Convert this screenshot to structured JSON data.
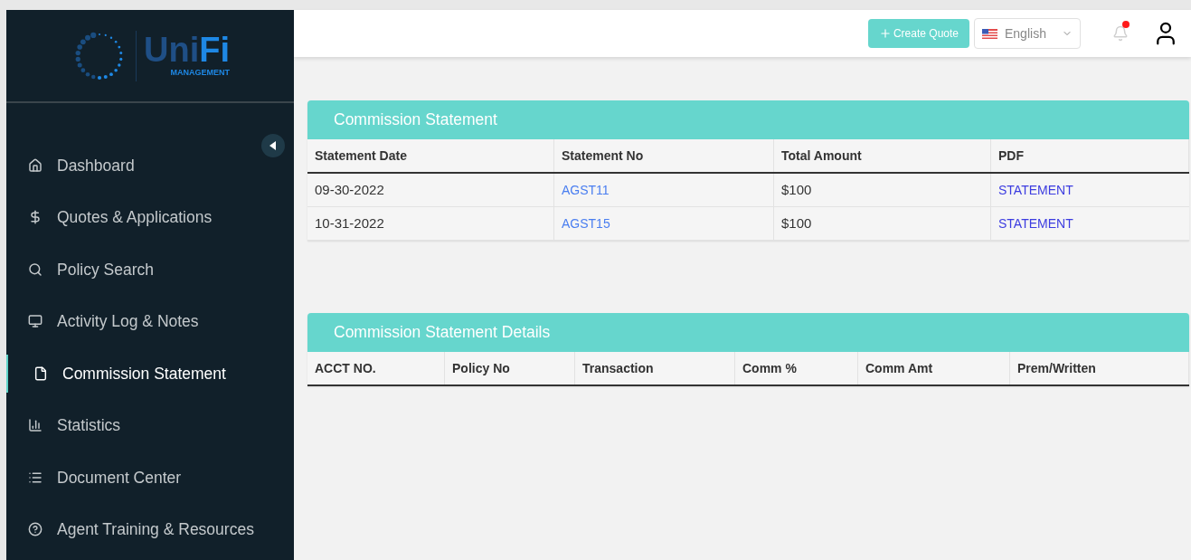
{
  "logo": {
    "name_first": "Uni",
    "name_second": "Fi",
    "tagline": "MANAGEMENT"
  },
  "sidebar": {
    "items": [
      {
        "label": "Dashboard",
        "selected": false
      },
      {
        "label": "Quotes & Applications",
        "selected": false
      },
      {
        "label": "Policy Search",
        "selected": false
      },
      {
        "label": "Activity Log & Notes",
        "selected": false
      },
      {
        "label": "Commission Statement",
        "selected": true
      },
      {
        "label": "Statistics",
        "selected": false
      },
      {
        "label": "Document Center",
        "selected": false
      },
      {
        "label": "Agent Training & Resources",
        "selected": false
      }
    ]
  },
  "header": {
    "create_button": "Create Quote",
    "language": "English",
    "notification": true
  },
  "statement": {
    "title": "Commission Statement",
    "columns": [
      "Statement Date",
      "Statement No",
      "Total Amount",
      "PDF"
    ],
    "rows": [
      {
        "date": "09-30-2022",
        "number": "AGST11",
        "amount": "$100",
        "pdf": "STATEMENT"
      },
      {
        "date": "10-31-2022",
        "number": "AGST15",
        "amount": "$100",
        "pdf": "STATEMENT"
      }
    ]
  },
  "details": {
    "title": "Commission Statement Details",
    "columns": [
      "ACCT NO.",
      "Policy No",
      "Transaction",
      "Comm %",
      "Comm Amt",
      "Prem/Written"
    ]
  }
}
